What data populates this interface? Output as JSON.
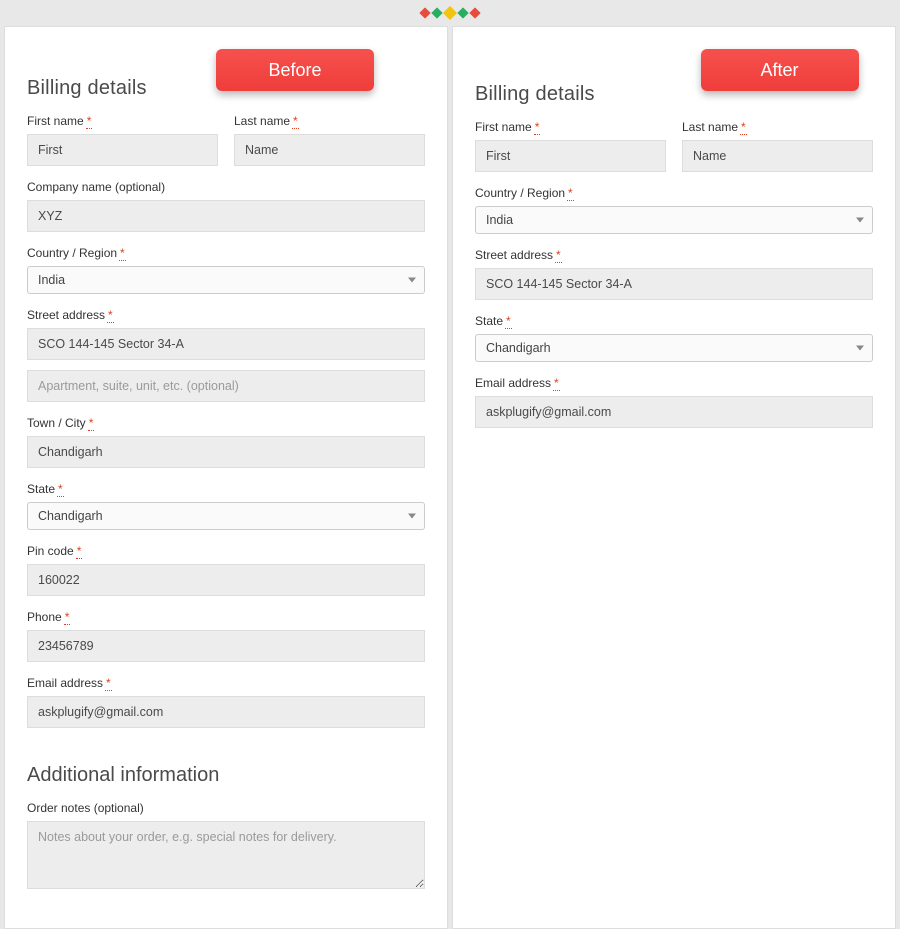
{
  "badges": {
    "before": "Before",
    "after": "After"
  },
  "left": {
    "title": "Billing details",
    "first_name": {
      "label": "First name",
      "value": "First"
    },
    "last_name": {
      "label": "Last name",
      "value": "Name"
    },
    "company": {
      "label": "Company name (optional)",
      "value": "XYZ"
    },
    "country": {
      "label": "Country / Region",
      "value": "India"
    },
    "street": {
      "label": "Street address",
      "value1": "SCO 144-145 Sector 34-A",
      "placeholder2": "Apartment, suite, unit, etc. (optional)"
    },
    "city": {
      "label": "Town / City",
      "value": "Chandigarh"
    },
    "state": {
      "label": "State",
      "value": "Chandigarh"
    },
    "pin": {
      "label": "Pin code",
      "value": "160022"
    },
    "phone": {
      "label": "Phone",
      "value": "23456789"
    },
    "email": {
      "label": "Email address",
      "value": "askplugify@gmail.com"
    },
    "additional_title": "Additional information",
    "order_notes": {
      "label": "Order notes (optional)",
      "placeholder": "Notes about your order, e.g. special notes for delivery."
    }
  },
  "right": {
    "title": "Billing details",
    "first_name": {
      "label": "First name",
      "value": "First"
    },
    "last_name": {
      "label": "Last name",
      "value": "Name"
    },
    "country": {
      "label": "Country / Region",
      "value": "India"
    },
    "street": {
      "label": "Street address",
      "value": "SCO 144-145 Sector 34-A"
    },
    "state": {
      "label": "State",
      "value": "Chandigarh"
    },
    "email": {
      "label": "Email address",
      "value": "askplugify@gmail.com"
    }
  }
}
